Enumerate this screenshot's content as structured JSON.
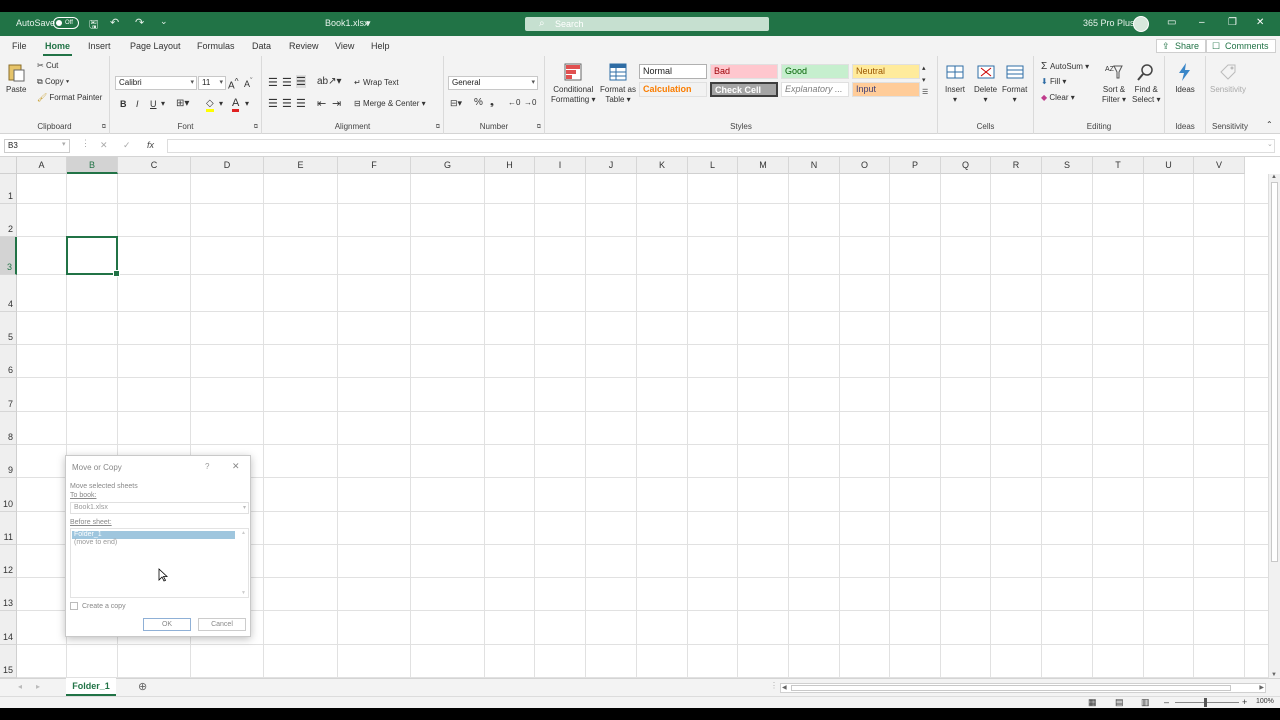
{
  "titlebar": {
    "autosave_label": "AutoSave",
    "autosave_state": "Off",
    "filename": "Book1.xlsx",
    "search_placeholder": "Search",
    "account": "365 Pro Plus"
  },
  "tabs": [
    "File",
    "Home",
    "Insert",
    "Page Layout",
    "Formulas",
    "Data",
    "Review",
    "View",
    "Help"
  ],
  "active_tab": "Home",
  "share_label": "Share",
  "comments_label": "Comments",
  "ribbon": {
    "clipboard": {
      "paste": "Paste",
      "cut": "Cut",
      "copy": "Copy",
      "format_painter": "Format Painter",
      "label": "Clipboard"
    },
    "font": {
      "name": "Calibri",
      "size": "11",
      "label": "Font"
    },
    "alignment": {
      "wrap": "Wrap Text",
      "merge": "Merge & Center",
      "label": "Alignment"
    },
    "number": {
      "format": "General",
      "label": "Number"
    },
    "styles": {
      "conditional1": "Conditional",
      "conditional2": "Formatting",
      "table1": "Format as",
      "table2": "Table",
      "normal": "Normal",
      "bad": "Bad",
      "good": "Good",
      "neutral": "Neutral",
      "calculation": "Calculation",
      "check": "Check Cell",
      "explanatory": "Explanatory ...",
      "input": "Input",
      "label": "Styles"
    },
    "cells": {
      "insert": "Insert",
      "delete": "Delete",
      "format": "Format",
      "label": "Cells"
    },
    "editing": {
      "autosum": "AutoSum",
      "fill": "Fill",
      "clear": "Clear",
      "sort1": "Sort &",
      "sort2": "Filter",
      "find1": "Find &",
      "find2": "Select",
      "label": "Editing"
    },
    "ideas": {
      "ideas": "Ideas",
      "label": "Ideas"
    },
    "sensitivity": {
      "sensitivity": "Sensitivity",
      "label": "Sensitivity"
    }
  },
  "formula_bar": {
    "name_box": "B3",
    "formula": ""
  },
  "columns": [
    "A",
    "B",
    "C",
    "D",
    "E",
    "F",
    "G",
    "H",
    "I",
    "J",
    "K",
    "L",
    "M",
    "N",
    "O",
    "P",
    "Q",
    "R",
    "S",
    "T",
    "U",
    "V"
  ],
  "rows": [
    "1",
    "2",
    "3",
    "4",
    "5",
    "6",
    "7",
    "8",
    "9",
    "10",
    "11",
    "12",
    "13",
    "14",
    "15"
  ],
  "selected_cell": "B3",
  "sheets": [
    "Folder_1"
  ],
  "zoom": "100%",
  "dialog": {
    "title": "Move or Copy",
    "help": "?",
    "close": "✕",
    "move_label": "Move selected sheets",
    "to_book_label": "To book:",
    "to_book_value": "Book1.xlsx",
    "before_sheet_label": "Before sheet:",
    "before_sheet_items": [
      "Folder_1",
      "(move to end)"
    ],
    "selected_item": "Folder_1",
    "create_copy_label": "Create a copy",
    "create_copy_checked": false,
    "ok_label": "OK",
    "cancel_label": "Cancel"
  }
}
